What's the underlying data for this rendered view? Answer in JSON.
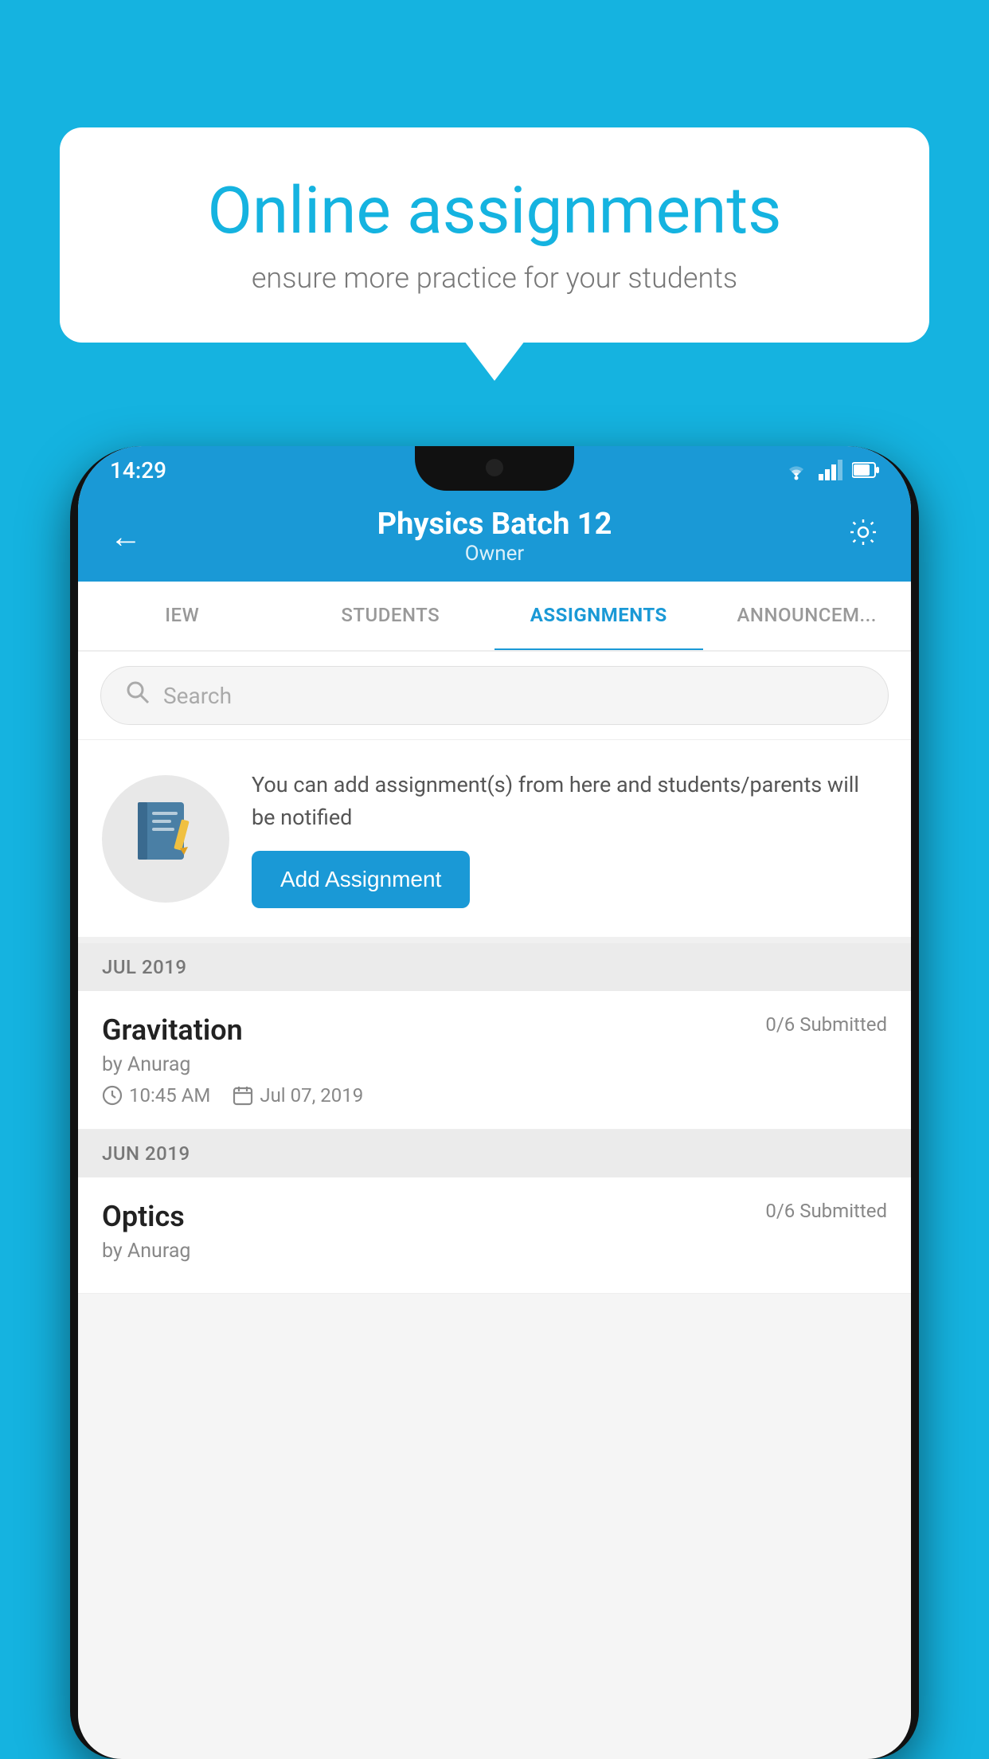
{
  "background_color": "#15b3e0",
  "bubble": {
    "title": "Online assignments",
    "subtitle": "ensure more practice for your students"
  },
  "phone": {
    "status_bar": {
      "time": "14:29",
      "icons": [
        "wifi",
        "signal",
        "battery"
      ]
    },
    "header": {
      "title": "Physics Batch 12",
      "subtitle": "Owner",
      "back_label": "←",
      "settings_label": "⚙"
    },
    "tabs": [
      {
        "label": "IEW",
        "active": false
      },
      {
        "label": "STUDENTS",
        "active": false
      },
      {
        "label": "ASSIGNMENTS",
        "active": true
      },
      {
        "label": "ANNOUNCEM...",
        "active": false
      }
    ],
    "search": {
      "placeholder": "Search"
    },
    "promo": {
      "text": "You can add assignment(s) from here and students/parents will be notified",
      "button_label": "Add Assignment"
    },
    "sections": [
      {
        "label": "JUL 2019",
        "assignments": [
          {
            "name": "Gravitation",
            "submitted": "0/6 Submitted",
            "by": "by Anurag",
            "time": "10:45 AM",
            "date": "Jul 07, 2019"
          }
        ]
      },
      {
        "label": "JUN 2019",
        "assignments": [
          {
            "name": "Optics",
            "submitted": "0/6 Submitted",
            "by": "by Anurag",
            "time": "",
            "date": ""
          }
        ]
      }
    ]
  }
}
